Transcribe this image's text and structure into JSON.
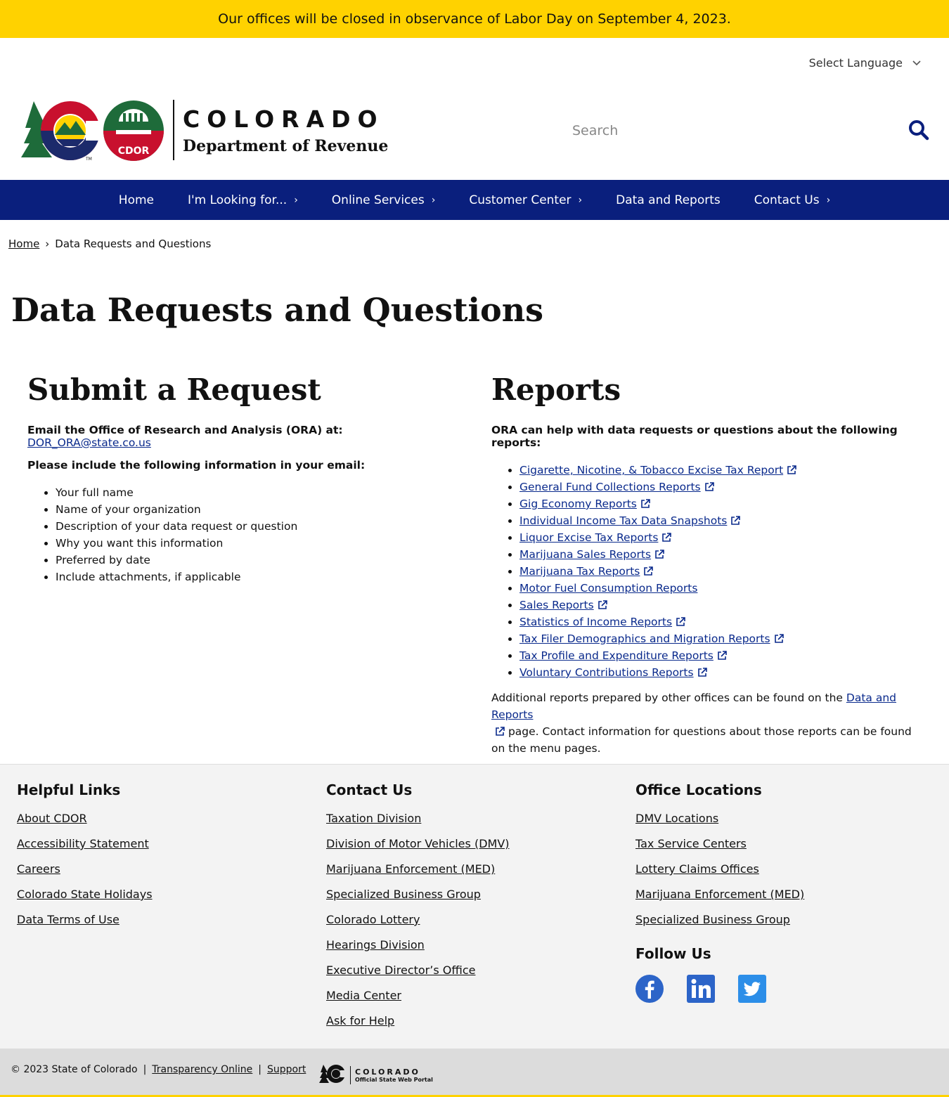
{
  "alert": {
    "text": "Our offices will be closed in observance of Labor Day on September 4, 2023."
  },
  "language": {
    "label": "Select Language"
  },
  "brand": {
    "state": "COLORADO",
    "dept": "Department of Revenue",
    "cdor_badge": "CDOR",
    "tm": "TM"
  },
  "search": {
    "placeholder": "Search"
  },
  "nav": {
    "items": [
      {
        "label": "Home"
      },
      {
        "label": "I'm Looking for...",
        "arrow": "›"
      },
      {
        "label": "Online Services",
        "arrow": "›"
      },
      {
        "label": "Customer Center",
        "arrow": "›"
      },
      {
        "label": "Data and Reports"
      },
      {
        "label": "Contact Us",
        "arrow": "›"
      }
    ]
  },
  "breadcrumb": {
    "home": "Home",
    "sep": "›",
    "current": "Data Requests and Questions"
  },
  "page": {
    "title": "Data Requests and Questions"
  },
  "submit": {
    "heading": "Submit a Request",
    "email_lead": "Email the Office of Research and Analysis (ORA) at:",
    "email": "DOR_ORA@state.co.us",
    "include_lead": "Please include the following information in your email:",
    "items": [
      "Your full name",
      "Name of your organization",
      "Description of your data request or question",
      "Why you want this information",
      "Preferred by date",
      "Include attachments, if applicable"
    ]
  },
  "reports": {
    "heading": "Reports",
    "lead": "ORA can help with data requests or questions about the following reports:",
    "items": [
      {
        "label": "Cigarette, Nicotine, & Tobacco Excise Tax Report",
        "external": true
      },
      {
        "label": "General Fund Collections Reports",
        "external": true
      },
      {
        "label": "Gig Economy Reports",
        "external": true
      },
      {
        "label": "Individual Income Tax Data Snapshots",
        "external": true
      },
      {
        "label": "Liquor Excise Tax Reports",
        "external": true
      },
      {
        "label": "Marijuana Sales Reports",
        "external": true
      },
      {
        "label": "Marijuana Tax Reports",
        "external": true
      },
      {
        "label": "Motor Fuel Consumption Reports",
        "external": false
      },
      {
        "label": "Sales Reports",
        "external": true
      },
      {
        "label": "Statistics of Income Reports",
        "external": true
      },
      {
        "label": "Tax Filer Demographics and Migration Reports",
        "external": true
      },
      {
        "label": "Tax Profile and Expenditure Reports",
        "external": true
      },
      {
        "label": "Voluntary Contributions Reports",
        "external": true
      }
    ],
    "additional_pre": "Additional reports prepared by other offices can be found on the",
    "additional_link": "Data and Reports",
    "additional_post": "page. Contact information for questions about those reports can be found on the menu pages."
  },
  "footer": {
    "helpful": {
      "heading": "Helpful Links",
      "links": [
        "About CDOR",
        "Accessibility Statement",
        "Careers",
        "Colorado State Holidays",
        "Data Terms of Use"
      ]
    },
    "contact": {
      "heading": "Contact Us",
      "links": [
        "Taxation Division",
        "Division of Motor Vehicles (DMV)",
        "Marijuana Enforcement (MED)",
        "Specialized Business Group",
        "Colorado Lottery",
        "Hearings Division",
        "Executive Director’s Office",
        "Media Center",
        "Ask for Help"
      ]
    },
    "offices": {
      "heading": "Office Locations",
      "links": [
        "DMV Locations",
        "Tax Service Centers",
        "Lottery Claims Offices",
        "Marijuana Enforcement (MED)",
        "Specialized Business Group"
      ]
    },
    "follow": {
      "heading": "Follow Us",
      "networks": [
        "facebook-icon",
        "linkedin-icon",
        "twitter-icon"
      ]
    }
  },
  "subfooter": {
    "copyright": "© 2023 State of Colorado",
    "sep": "|",
    "transparency": "Transparency Online",
    "support": "Support",
    "portal_title": "COLORADO",
    "portal_sub": "Official State Web Portal"
  },
  "colors": {
    "alert": "#ffd200",
    "nav": "#0a1f7d",
    "link": "#0a2a8c",
    "footer": "#f3f3f3"
  }
}
